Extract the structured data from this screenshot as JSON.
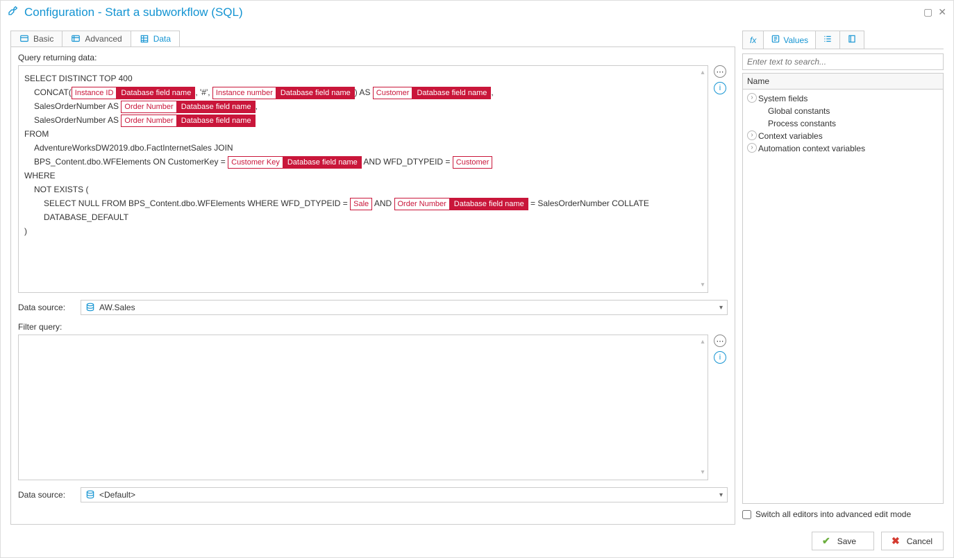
{
  "window": {
    "title": "Configuration - Start a subworkflow (SQL)"
  },
  "tabs": {
    "basic": "Basic",
    "advanced": "Advanced",
    "data": "Data"
  },
  "labels": {
    "query_returning": "Query returning data:",
    "filter_query": "Filter query:",
    "data_source": "Data source:",
    "name_col": "Name",
    "switch_editmode": "Switch all editors into advanced edit mode"
  },
  "sql": {
    "l1": "SELECT DISTINCT TOP 400",
    "l2_a": "CONCAT(",
    "pill_instance_id": "Instance ID",
    "pill_dbfield": "Database field name",
    "l2_b": ", '#', ",
    "pill_instance_number": "Instance number",
    "l2_c": ") AS ",
    "pill_customer": "Customer",
    "l2_d": ",",
    "l3_a": "SalesOrderNumber AS ",
    "pill_order_number": "Order Number",
    "l3_b": ",",
    "l4_a": "SalesOrderNumber AS ",
    "l5": "FROM",
    "l6": "AdventureWorksDW2019.dbo.FactInternetSales JOIN",
    "l7_a": "BPS_Content.dbo.WFElements ON CustomerKey = ",
    "pill_customer_key": "Customer Key",
    "l7_b": " AND WFD_DTYPEID = ",
    "l8": "WHERE",
    "l9": "NOT EXISTS (",
    "l10_a": "SELECT NULL FROM BPS_Content.dbo.WFElements WHERE WFD_DTYPEID = ",
    "pill_sale": "Sale",
    "l10_b": " AND ",
    "l10_c": " = SalesOrderNumber COLLATE DATABASE_DEFAULT",
    "l11": ")"
  },
  "ds1": "AW.Sales",
  "ds2": "<Default>",
  "right": {
    "tab_values": "Values",
    "search_placeholder": "Enter text to search...",
    "tree": {
      "system_fields": "System fields",
      "global_constants": "Global constants",
      "process_constants": "Process constants",
      "context_variables": "Context variables",
      "automation_context": "Automation context variables"
    }
  },
  "footer": {
    "save": "Save",
    "cancel": "Cancel"
  }
}
